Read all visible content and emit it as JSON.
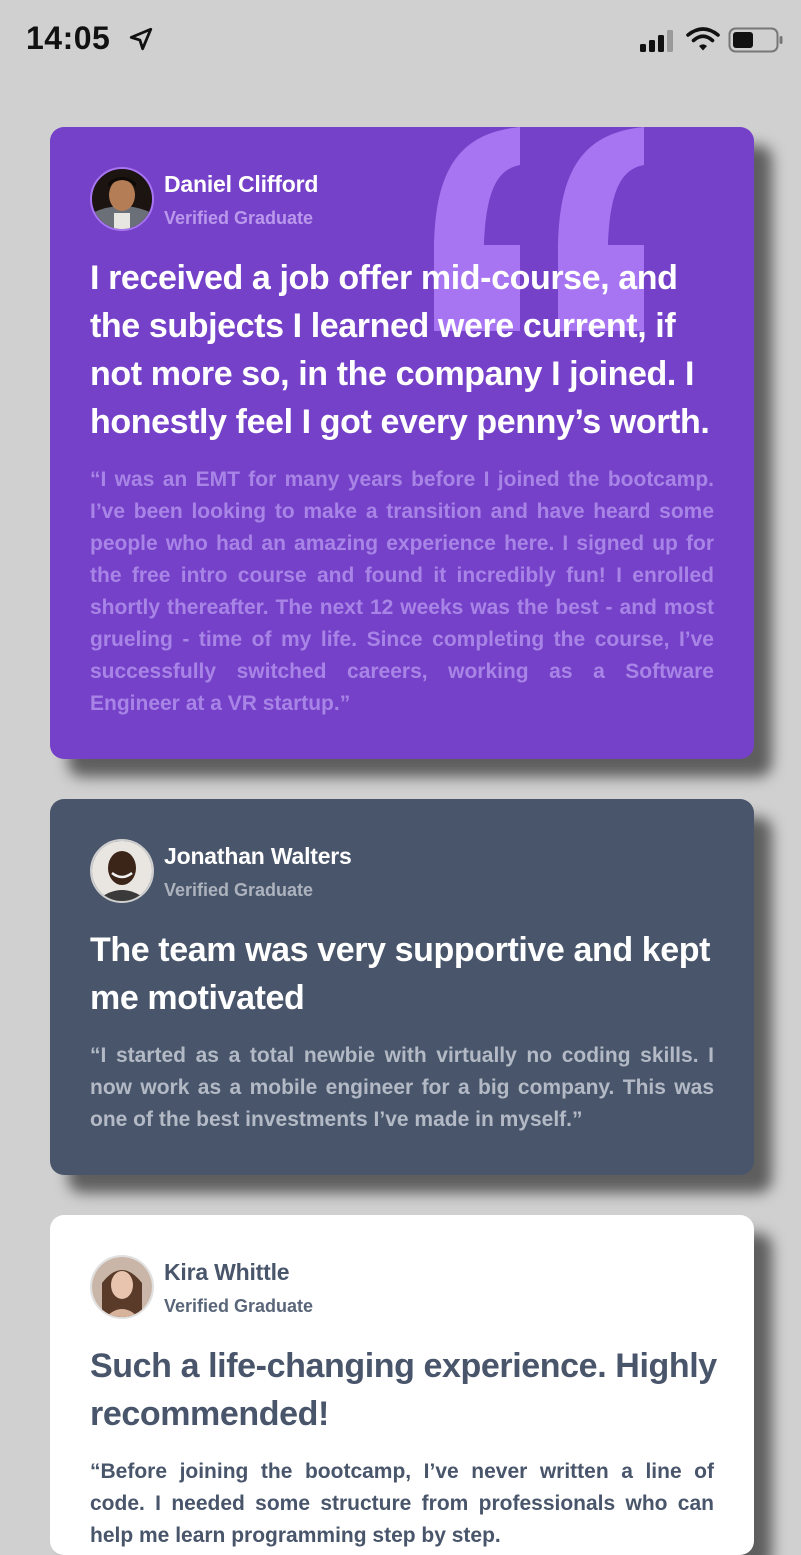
{
  "status_bar": {
    "time": "14:05",
    "icons": [
      "location-arrow-icon",
      "cellular-signal-icon",
      "wifi-icon",
      "battery-icon"
    ]
  },
  "colors": {
    "background": "#d0d0d0",
    "violet": "#7541c8",
    "grayish_blue": "#48556a",
    "white": "#ffffff",
    "quote_mark": "#a775f1"
  },
  "testimonials": [
    {
      "name": "Daniel Clifford",
      "status": "Verified Graduate",
      "headline": "I received a job offer mid-course, and the subjects I learned were current, if not more so, in the company I joined. I honestly feel I got every penny’s worth.",
      "body": "“I was an EMT for many years before I joined the bootcamp. I’ve been looking to make a transition and have heard some people who had an amazing experience here. I signed up for the free intro course and found it incredibly fun! I enrolled shortly thereafter. The next 12 weeks was the best - and most grueling - time of my life. Since completing the course, I’ve successfully switched careers, working as a Software Engineer at a VR startup.”"
    },
    {
      "name": "Jonathan Walters",
      "status": "Verified Graduate",
      "headline": "The team was very supportive and kept me motivated",
      "body": "“I started as a total newbie with virtually no coding skills. I now work as a mobile engineer for a big company. This was one of the best investments I’ve made in myself.”"
    },
    {
      "name": "Kira Whittle",
      "status": "Verified Graduate",
      "headline": "Such a life-changing experience. Highly recommended!",
      "body": "“Before joining the bootcamp, I’ve never written a line of code. I needed some structure from professionals who can help me learn programming step by step."
    }
  ]
}
